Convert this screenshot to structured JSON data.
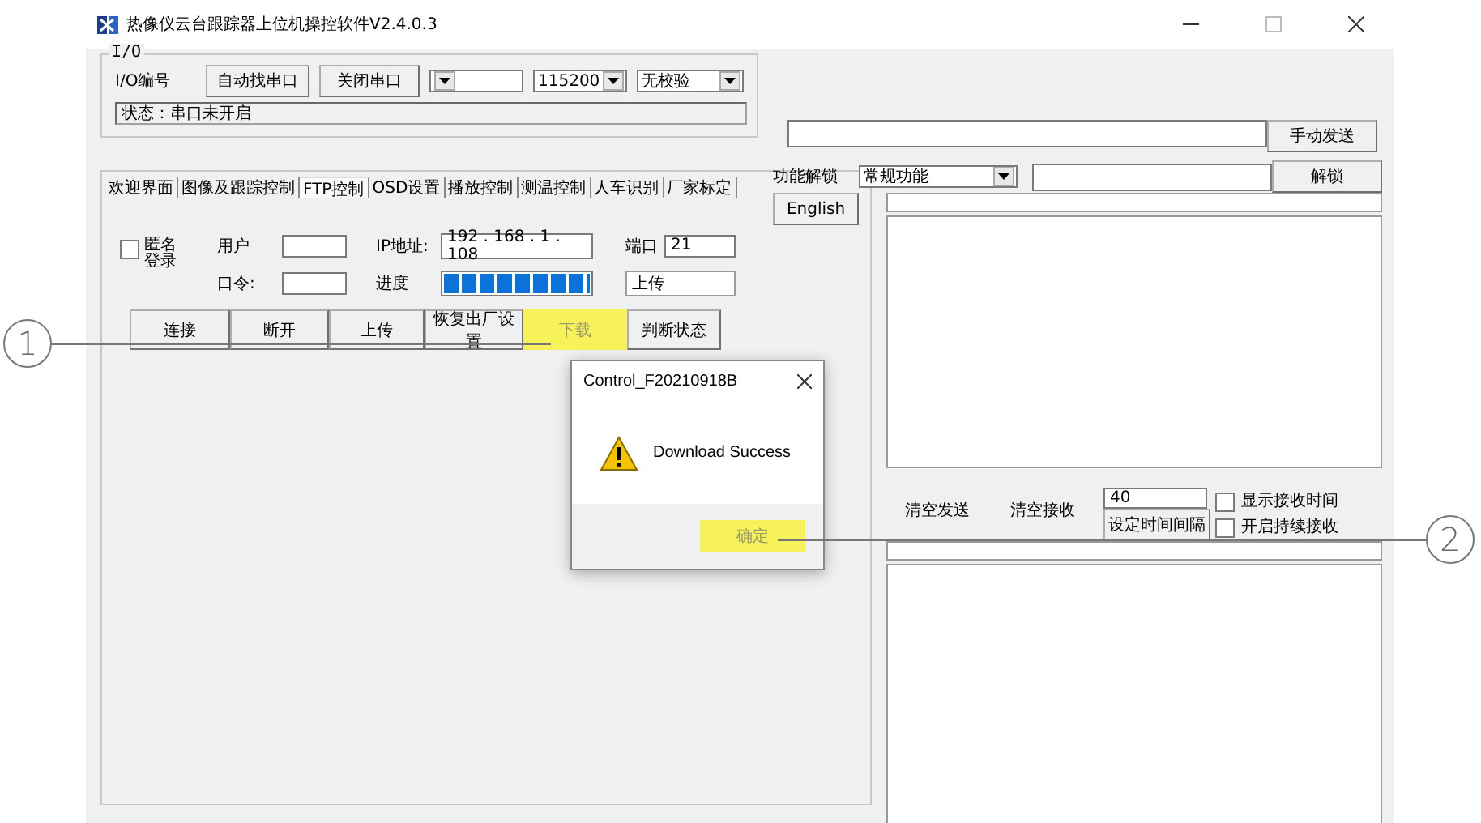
{
  "window": {
    "title": "热像仪云台跟踪器上位机操控软件V2.4.0.3"
  },
  "io_group": {
    "legend": "I/O",
    "label": "I/O编号",
    "buttons": [
      "自动找串口",
      "关闭串口"
    ],
    "combos": [
      {
        "value": "115200"
      },
      {
        "value": "无校验"
      }
    ],
    "status": "状态：串口未开启"
  },
  "send_button": "手动发送",
  "unlock": {
    "label": "功能解锁",
    "combo": "常规功能",
    "button": "解锁"
  },
  "language_button": "English",
  "tabs": [
    {
      "label": "欢迎界面",
      "selected": false
    },
    {
      "label": "图像及跟踪控制",
      "selected": false
    },
    {
      "label": "FTP控制",
      "selected": true
    },
    {
      "label": "OSD设置",
      "selected": false
    },
    {
      "label": "播放控制",
      "selected": false
    },
    {
      "label": "测温控制",
      "selected": false
    },
    {
      "label": "人车识别",
      "selected": false
    },
    {
      "label": "厂家标定",
      "selected": false
    }
  ],
  "ftp": {
    "anonymous": {
      "label": "匿名登录",
      "checked": false
    },
    "user_label": "用户",
    "password_label": "口令:",
    "ip_label": "IP地址:",
    "ip": "192 . 168 .  1  . 108",
    "port_label": "端口",
    "port": "21",
    "progress_label": "进度",
    "progress": {
      "level": 1
    },
    "status": "上传",
    "buttons": [
      {
        "label": "连接",
        "highlighted": false
      },
      {
        "label": "断开",
        "highlighted": false
      },
      {
        "label": "上传",
        "highlighted": false
      },
      {
        "label": "恢复出厂设置",
        "highlighted": false
      },
      {
        "label": "下载",
        "highlighted": true
      },
      {
        "label": "判断状态",
        "highlighted": false
      }
    ]
  },
  "receive": {
    "clear_send": "清空发送",
    "clear_receive": "清空接收",
    "interval": "40",
    "interval_button": "设定时间间隔",
    "options": [
      {
        "label": "显示接收时间",
        "checked": false
      },
      {
        "label": "开启持续接收",
        "checked": false
      }
    ]
  },
  "dialog": {
    "title": "Control_F20210918B",
    "message": "Download Success",
    "ok": {
      "label": "确定",
      "highlighted": true
    }
  },
  "callouts": [
    {
      "label": "1"
    },
    {
      "label": "2"
    }
  ]
}
